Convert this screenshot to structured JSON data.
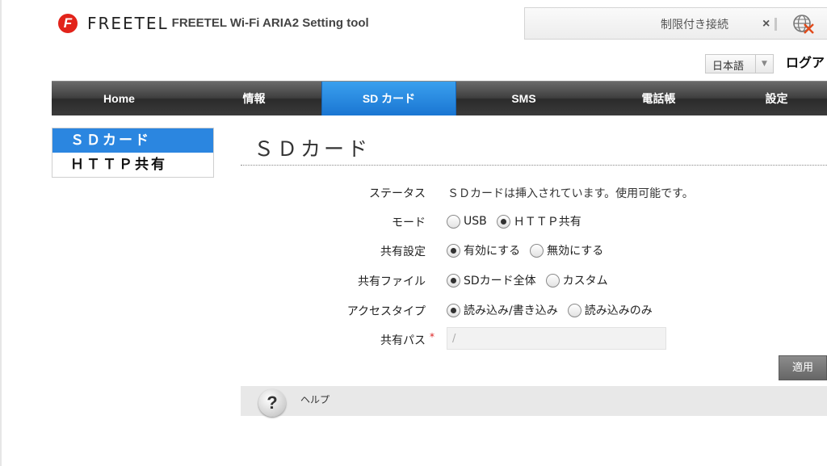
{
  "header": {
    "brand": "FREETEL",
    "brand_icon": "freetel-logo-icon",
    "app_title": "FREETEL Wi-Fi ARIA2 Setting tool",
    "connection_status": "制限付き接続",
    "disconnect_label": "×",
    "globe_icon": "globe-no-connection-icon",
    "language": "日本語",
    "logout": "ログア"
  },
  "nav": [
    {
      "label": "Home"
    },
    {
      "label": "情報"
    },
    {
      "label": "SD カード",
      "active": true
    },
    {
      "label": "SMS"
    },
    {
      "label": "電話帳"
    },
    {
      "label": "設定"
    }
  ],
  "sidebar": {
    "items": [
      {
        "label": "ＳＤカード",
        "active": true
      },
      {
        "label": "ＨＴＴＰ共有"
      }
    ]
  },
  "main": {
    "title": "ＳＤカード",
    "status_label": "ステータス",
    "status_value": "ＳＤカードは挿入されています。使用可能です。",
    "mode_label": "モード",
    "mode_options": [
      "USB",
      "ＨＴＴＰ共有"
    ],
    "mode_selected": "ＨＴＴＰ共有",
    "share_label": "共有設定",
    "share_options": [
      "有効にする",
      "無効にする"
    ],
    "share_selected": "有効にする",
    "file_label": "共有ファイル",
    "file_options": [
      "SDカード全体",
      "カスタム"
    ],
    "file_selected": "SDカード全体",
    "access_label": "アクセスタイプ",
    "access_options": [
      "読み込み/書き込み",
      "読み込みのみ"
    ],
    "access_selected": "読み込み/書き込み",
    "path_label": "共有パス",
    "path_required": "*",
    "path_value": "/",
    "apply_button": "適用"
  },
  "help": {
    "icon": "help-question-icon",
    "icon_glyph": "?",
    "label": "ヘルプ"
  },
  "colors": {
    "accent": "#2b86e0",
    "nav_dark": "#3a3a3a",
    "brand_red": "#e2231a"
  }
}
